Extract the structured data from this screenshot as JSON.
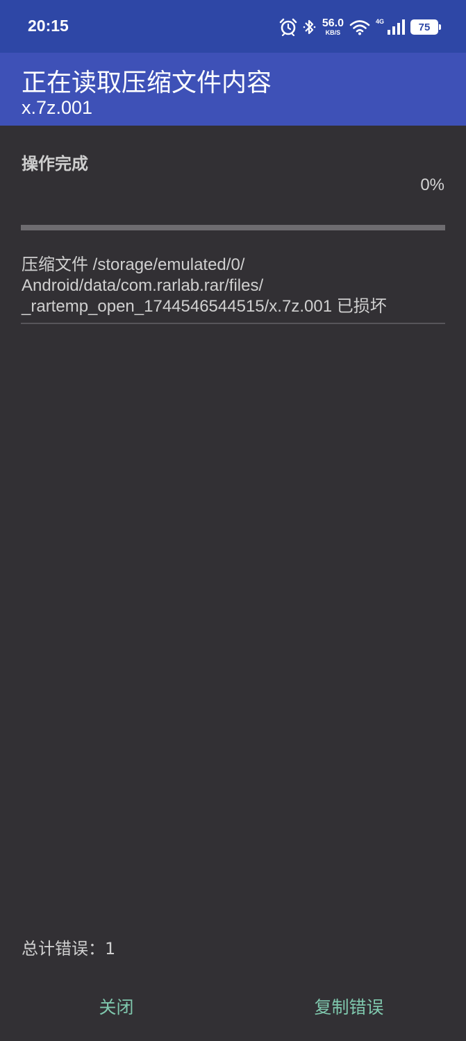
{
  "status_bar": {
    "time": "20:15",
    "icons": [
      "alarm-icon",
      "bluetooth-icon",
      "wifi-icon",
      "signal-icon"
    ],
    "net_speed_value": "56.0",
    "net_speed_unit": "KB/S",
    "network_type": "4G",
    "battery_level": "75"
  },
  "app_bar": {
    "title": "正在读取压缩文件内容",
    "subtitle": "x.7z.001"
  },
  "operation": {
    "status": "操作完成",
    "progress_text": "0%",
    "progress_value": 0
  },
  "error_message": "压缩文件 /storage/emulated/0/\nAndroid/data/com.rarlab.rar/files/\n_rartemp_open_1744546544515/x.7z.001 已损坏",
  "footer": {
    "total_errors": "总计错误：1",
    "close_label": "关闭",
    "copy_errors_label": "复制错误"
  },
  "colors": {
    "status_bar": "#2e47a6",
    "app_bar": "#3e51b7",
    "background": "#323034",
    "accent_button": "#7fc7ad"
  }
}
